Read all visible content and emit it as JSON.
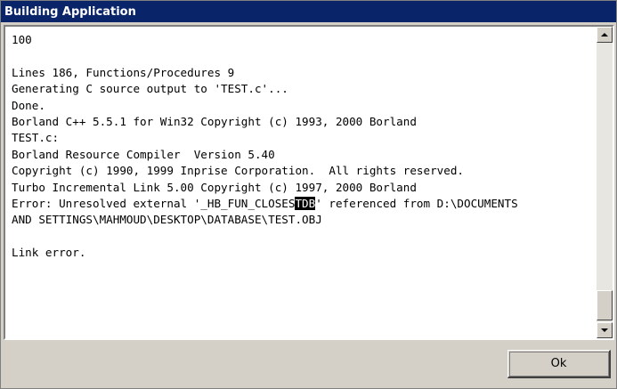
{
  "window": {
    "title": "Building Application"
  },
  "log": {
    "lines": [
      "100",
      "",
      "Lines 186, Functions/Procedures 9",
      "Generating C source output to 'TEST.c'...",
      "Done.",
      "Borland C++ 5.5.1 for Win32 Copyright (c) 1993, 2000 Borland",
      "TEST.c:",
      "Borland Resource Compiler  Version 5.40",
      "Copyright (c) 1990, 1999 Inprise Corporation.  All rights reserved.",
      "Turbo Incremental Link 5.00 Copyright (c) 1997, 2000 Borland",
      "Error: Unresolved external '_HB_FUN_CLOSESTDB' referenced from D:\\DOCUMENTS",
      "AND SETTINGS\\MAHMOUD\\DESKTOP\\DATABASE\\TEST.OBJ",
      "",
      "Link error."
    ],
    "error_prefix": "Error: Unresolved external '_HB_FUN_CLOSES",
    "error_selected": "TDB",
    "error_suffix": "' referenced from D:\\DOCUMENTS"
  },
  "buttons": {
    "ok_label": "Ok"
  },
  "icons": {
    "scroll_up": "arrow-up-icon",
    "scroll_down": "arrow-down-icon"
  },
  "colors": {
    "titlebar": "#0a246a",
    "face": "#d4d0c8",
    "selection": "#000000"
  }
}
